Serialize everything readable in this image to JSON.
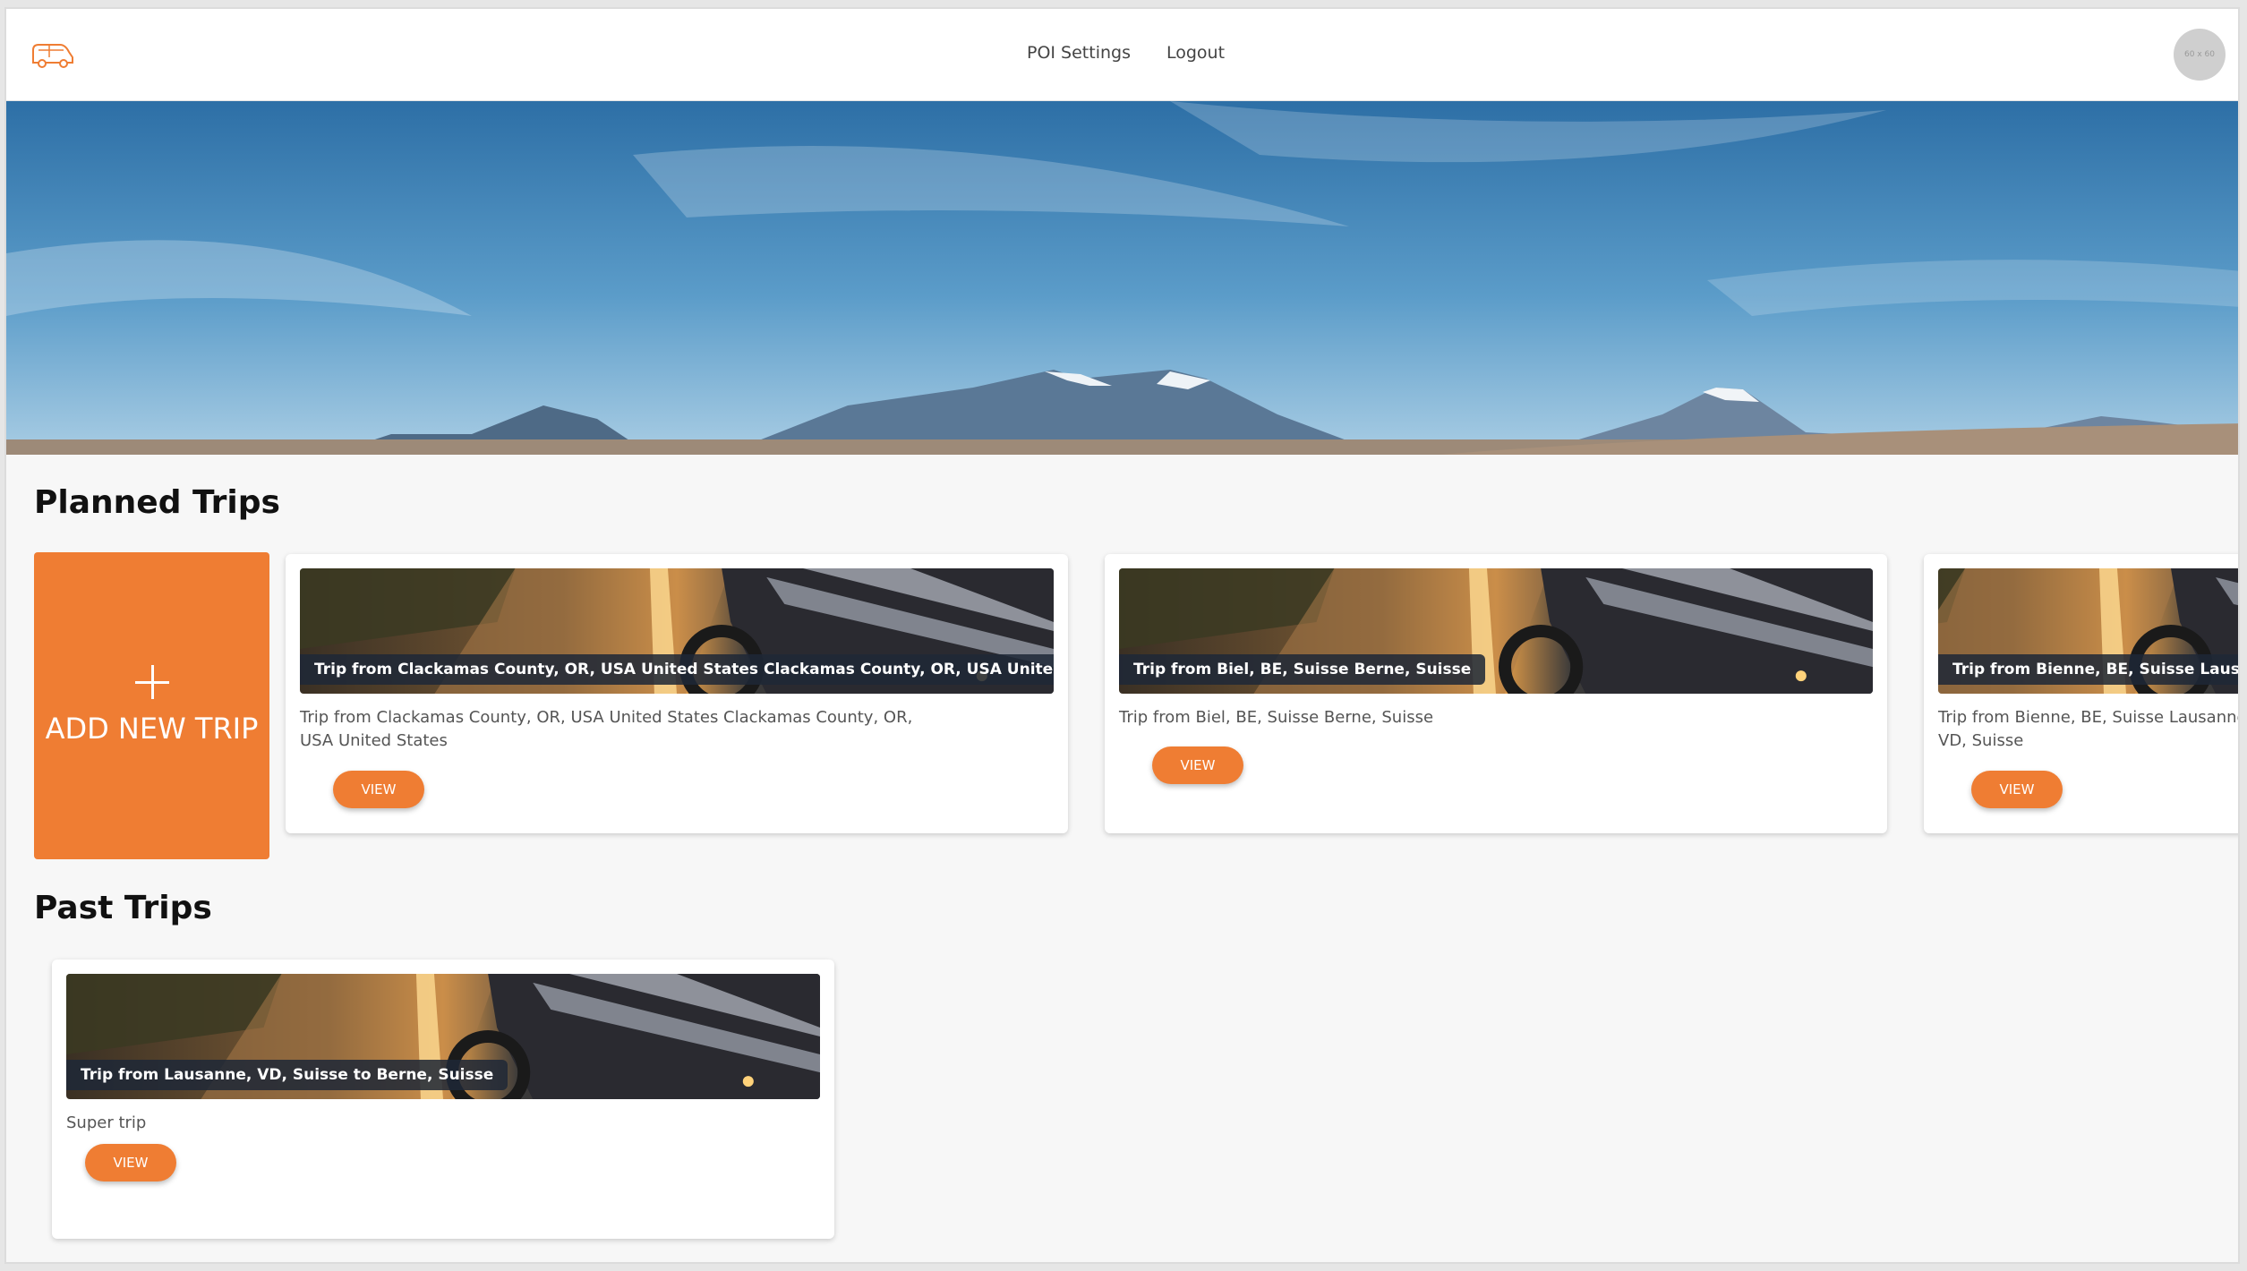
{
  "header": {
    "nav": [
      {
        "label": "POI Settings"
      },
      {
        "label": "Logout"
      }
    ],
    "avatar_text": "60 x 60"
  },
  "planned": {
    "title": "Planned Trips",
    "add_label": "ADD NEW TRIP",
    "trips": [
      {
        "caption": "Trip from Clackamas County, OR, USA United States Clackamas County, OR, USA United States",
        "description": "Trip from Clackamas County, OR, USA United States Clackamas County, OR, USA United States",
        "button": "VIEW"
      },
      {
        "caption": "Trip from Biel, BE, Suisse Berne, Suisse",
        "description": "Trip from Biel, BE, Suisse Berne, Suisse",
        "button": "VIEW"
      },
      {
        "caption": "Trip from Bienne, BE, Suisse Lausanne, VD, Suisse",
        "description": "Trip from Bienne, BE, Suisse Lausanne, VD, Suisse",
        "button": "VIEW"
      }
    ]
  },
  "past": {
    "title": "Past Trips",
    "trips": [
      {
        "caption": "Trip from Lausanne, VD, Suisse to Berne, Suisse",
        "description": "Super trip",
        "button": "VIEW"
      }
    ]
  },
  "colors": {
    "accent": "#ef7d33",
    "background": "#f7f7f7"
  }
}
